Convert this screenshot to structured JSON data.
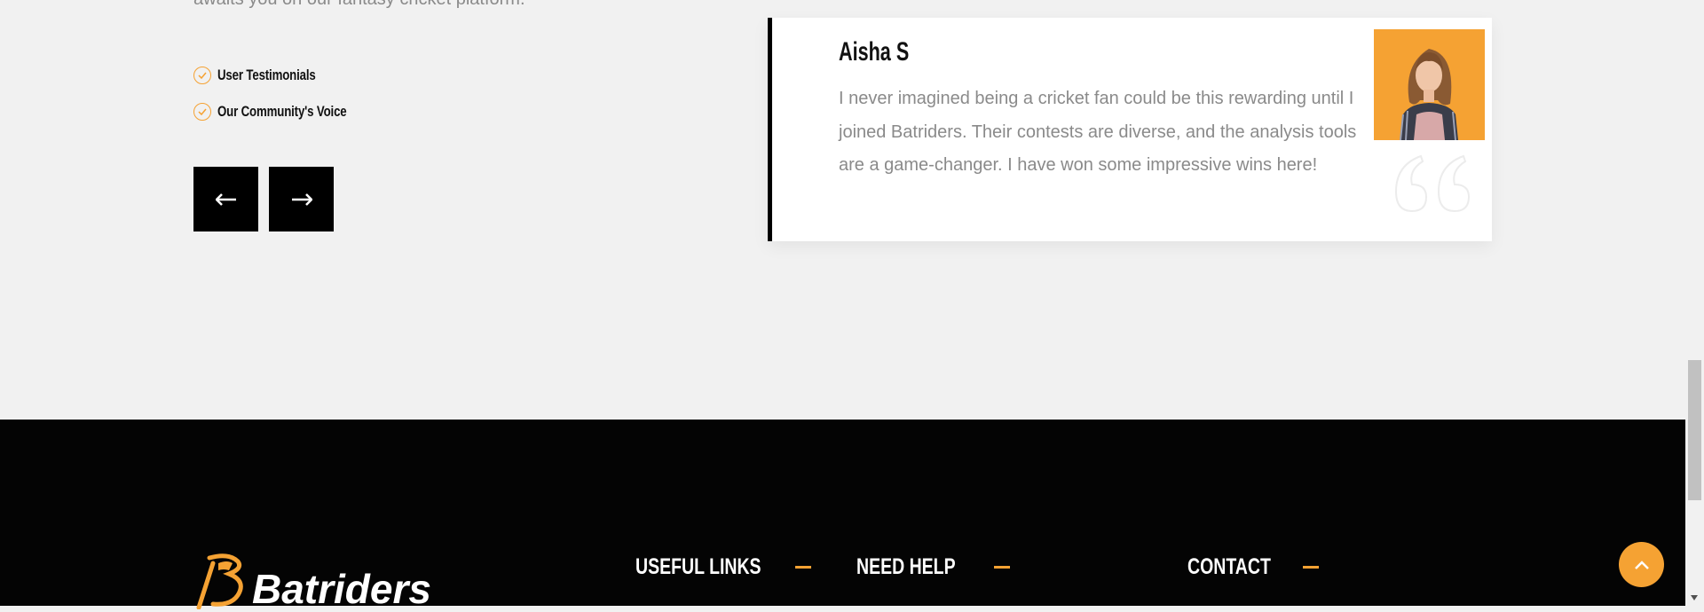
{
  "intro": {
    "partial_text": "awaits you on our fantasy cricket platform."
  },
  "features": [
    {
      "label": "User Testimonials"
    },
    {
      "label": "Our Community's Voice"
    }
  ],
  "testimonial": {
    "name": "Aisha S",
    "text": "I never imagined being a cricket fan could be this rewarding until I joined Batriders. Their contests are diverse, and the analysis tools are a game-changer. I have won some impressive wins here!"
  },
  "footer": {
    "logo_text": "Batriders",
    "headings": {
      "useful_links": "USEFUL LINKS",
      "need_help": "NEED HELP",
      "contact": "CONTACT"
    }
  },
  "icons": [
    "check-circle-icon",
    "arrow-left-icon",
    "arrow-right-icon",
    "quote-icon",
    "chevron-up-icon",
    "scroll-down-arrow-icon"
  ],
  "colors": {
    "accent": "#f5a233",
    "background": "#f1f1f1",
    "footer": "#040404",
    "text_muted": "#8a8a8a"
  }
}
